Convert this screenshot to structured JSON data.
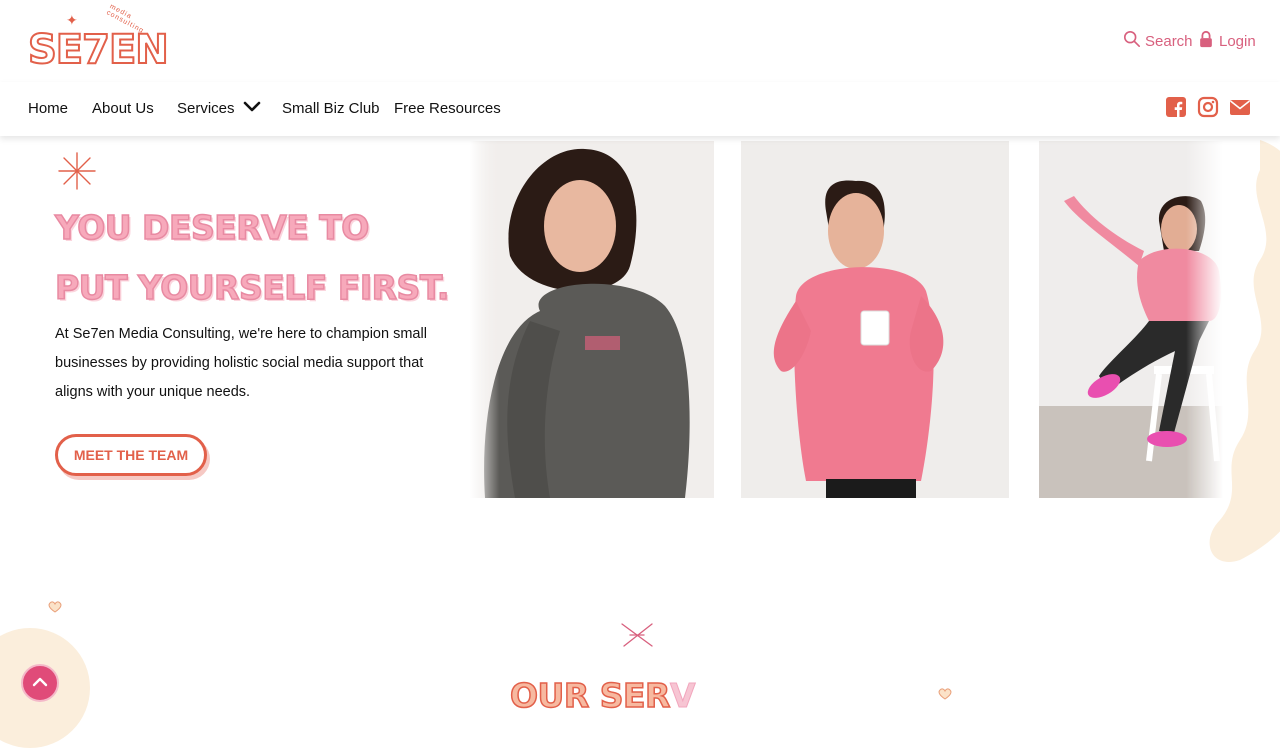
{
  "brand": {
    "logo_text": "SE7EN",
    "logo_tagline": "media consulting"
  },
  "header": {
    "search_label": "Search",
    "login_label": "Login"
  },
  "nav": {
    "items": [
      {
        "label": "Home"
      },
      {
        "label": "About Us"
      },
      {
        "label": "Services"
      },
      {
        "label": "Small Biz Club"
      },
      {
        "label": "Free Resources"
      }
    ],
    "social_icons": [
      "facebook-icon",
      "instagram-icon",
      "email-icon"
    ]
  },
  "hero": {
    "headline_line1": "YOU DESERVE TO",
    "headline_line2": "PUT YOURSELF FIRST.",
    "description": "At Se7en Media Consulting, we're here to champion small businesses by providing holistic social media support that aligns with your unique needs.",
    "cta_label": "MEET THE TEAM"
  },
  "services": {
    "title_visible": "OUR SER",
    "title_fading": "V"
  },
  "colors": {
    "brand_orange": "#e2604a",
    "brand_pink": "#d8607e",
    "headline_pink": "#f7a9bb",
    "scroll_button": "#e04b79",
    "cream": "#fbeedc"
  },
  "icons": {
    "search": "search-icon",
    "login": "lock-icon",
    "dropdown": "chevron-down-icon",
    "scroll_top": "chevron-up-icon"
  }
}
